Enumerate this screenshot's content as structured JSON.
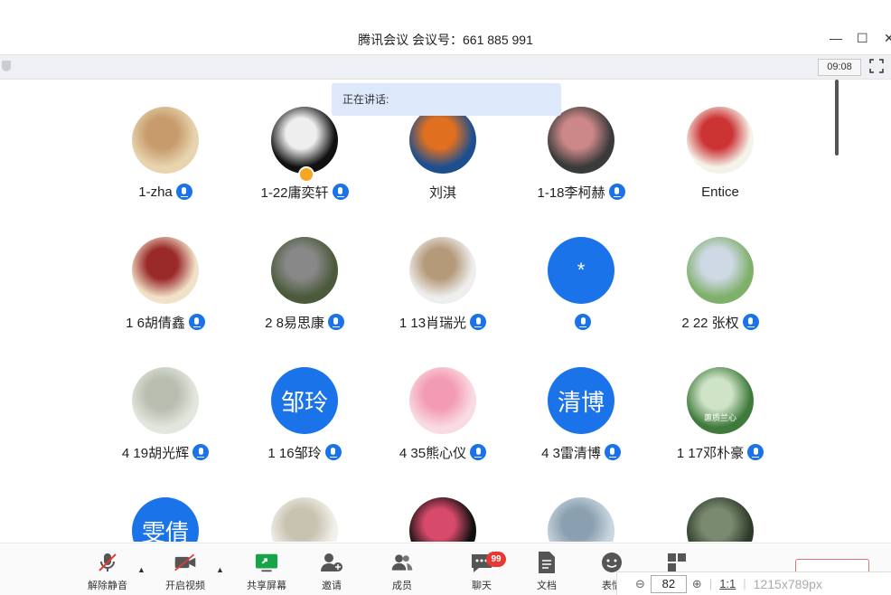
{
  "window": {
    "title": "腾讯会议 会议号：661 885 991",
    "controls": [
      "—",
      "☐",
      "✕"
    ]
  },
  "status": {
    "timer": "09:08",
    "speaking_label": "正在讲话:"
  },
  "participants": [
    {
      "name": "1-zha",
      "muted": false,
      "avatar": {
        "type": "photo",
        "colors": [
          "#e8d5b0",
          "#c79b6b"
        ]
      }
    },
    {
      "name": "1-22庸奕轩",
      "muted": false,
      "host": true,
      "avatar": {
        "type": "photo",
        "colors": [
          "#111",
          "#eee"
        ]
      }
    },
    {
      "name": "刘淇",
      "muted": null,
      "avatar": {
        "type": "photo",
        "colors": [
          "#1d4f8f",
          "#e07020"
        ]
      }
    },
    {
      "name": "1-18李柯赫",
      "muted": false,
      "avatar": {
        "type": "photo",
        "colors": [
          "#3a3a3a",
          "#c88"
        ]
      }
    },
    {
      "name": "Entice",
      "muted": null,
      "avatar": {
        "type": "photo",
        "colors": [
          "#f5f2ea",
          "#c33"
        ]
      }
    },
    {
      "name": "1 6胡倩鑫",
      "muted": false,
      "avatar": {
        "type": "photo",
        "colors": [
          "#f1e1c8",
          "#9a2a2a"
        ]
      }
    },
    {
      "name": "2 8易思康",
      "muted": false,
      "avatar": {
        "type": "photo",
        "colors": [
          "#4a5a3a",
          "#888"
        ]
      }
    },
    {
      "name": "1 13肖瑞光",
      "muted": false,
      "avatar": {
        "type": "photo",
        "colors": [
          "#eeeeee",
          "#b59a7a"
        ]
      }
    },
    {
      "name": "",
      "muted": false,
      "avatar": {
        "type": "star",
        "text": "*"
      }
    },
    {
      "name": "2 22 张权",
      "muted": false,
      "avatar": {
        "type": "photo",
        "colors": [
          "#7fb06a",
          "#cfd9e6"
        ]
      }
    },
    {
      "name": "4 19胡光辉",
      "muted": false,
      "avatar": {
        "type": "photo",
        "colors": [
          "#e2e6dc",
          "#b8bdb0"
        ]
      }
    },
    {
      "name": "1 16邹玲",
      "muted": false,
      "avatar": {
        "type": "text",
        "text": "邹玲"
      }
    },
    {
      "name": "4 35熊心仪",
      "muted": false,
      "avatar": {
        "type": "photo",
        "colors": [
          "#f9dbe3",
          "#f39bb2"
        ]
      }
    },
    {
      "name": "4 3雷清博",
      "muted": false,
      "avatar": {
        "type": "text",
        "text": "清博"
      }
    },
    {
      "name": "1 17邓朴豪",
      "muted": false,
      "avatar": {
        "type": "photo",
        "colors": [
          "#3f7a3c",
          "#cfe3c6"
        ],
        "caption": "蕙质兰心"
      }
    },
    {
      "name": "",
      "muted": null,
      "avatar": {
        "type": "text",
        "text": "雯倩"
      }
    },
    {
      "name": "",
      "muted": null,
      "avatar": {
        "type": "photo",
        "colors": [
          "#f2f0ea",
          "#c8c2b0"
        ]
      }
    },
    {
      "name": "",
      "muted": null,
      "avatar": {
        "type": "photo",
        "colors": [
          "#101010",
          "#d84a6a"
        ]
      }
    },
    {
      "name": "",
      "muted": null,
      "avatar": {
        "type": "photo",
        "colors": [
          "#c9d6e0",
          "#8aa0b0"
        ]
      }
    },
    {
      "name": "",
      "muted": null,
      "avatar": {
        "type": "photo",
        "colors": [
          "#2f3b2a",
          "#7a8a70"
        ]
      }
    }
  ],
  "toolbar": {
    "items": [
      {
        "label": "解除静音",
        "icon": "mic-off-icon"
      },
      {
        "label": "开启视频",
        "icon": "video-off-icon"
      },
      {
        "label": "共享屏幕",
        "icon": "share-screen-icon"
      },
      {
        "label": "邀请",
        "icon": "invite-icon"
      },
      {
        "label": "成员",
        "icon": "members-icon"
      },
      {
        "label": "聊天",
        "icon": "chat-icon"
      },
      {
        "label": "文档",
        "icon": "document-icon"
      },
      {
        "label": "表情",
        "icon": "emoji-icon"
      },
      {
        "label": "",
        "icon": "apps-icon"
      }
    ],
    "chat_badge": "99"
  },
  "viewer": {
    "zoom_value": "82",
    "ratio_label": "1:1",
    "dimensions": "1215x789px"
  },
  "colors": {
    "accent": "#1a73e8",
    "speaking_bg": "#dde9fb",
    "badge": "#e53935"
  }
}
